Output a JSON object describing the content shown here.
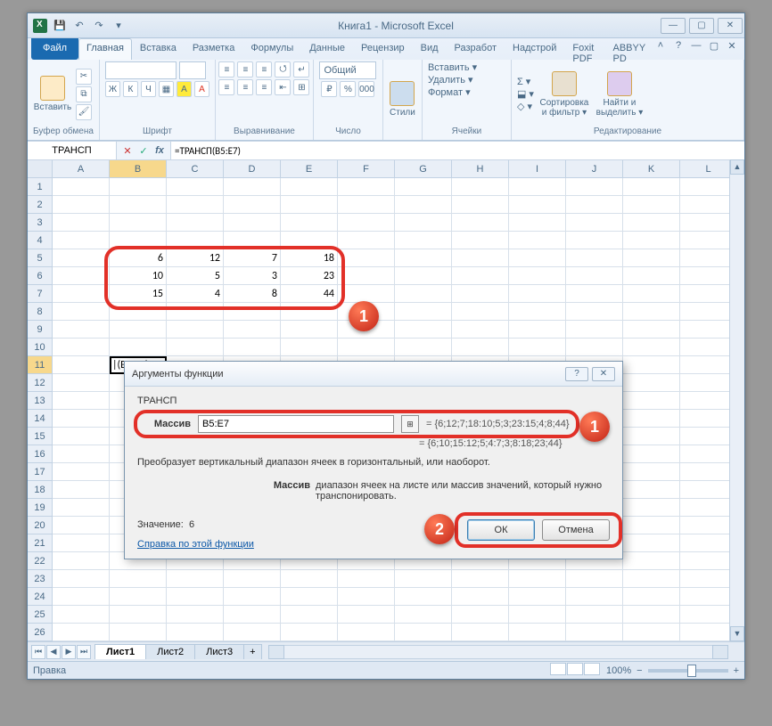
{
  "title": "Книга1 - Microsoft Excel",
  "qat": {
    "save": "💾",
    "undo": "↶",
    "redo": "↷",
    "down": "▾"
  },
  "win": {
    "min": "—",
    "max": "▢",
    "close": "✕"
  },
  "tabs": {
    "file": "Файл",
    "items": [
      "Главная",
      "Вставка",
      "Разметка",
      "Формулы",
      "Данные",
      "Рецензир",
      "Вид",
      "Разработ",
      "Надстрой",
      "Foxit PDF",
      "ABBYY PD"
    ],
    "active": 0
  },
  "help": {
    "min": "˄",
    "q": "?",
    "wmin": "—",
    "wmax": "▢",
    "wclose": "✕"
  },
  "ribbon": {
    "clipboard": {
      "paste": "Вставить",
      "label": "Буфер обмена"
    },
    "font": {
      "label": "Шрифт",
      "bold": "Ж",
      "italic": "К",
      "underline": "Ч"
    },
    "align": {
      "label": "Выравнивание"
    },
    "number": {
      "format": "Общий",
      "label": "Число"
    },
    "styles": {
      "btn": "Стили"
    },
    "cells": {
      "insert": "Вставить ▾",
      "delete": "Удалить ▾",
      "format": "Формат ▾",
      "label": "Ячейки"
    },
    "editing": {
      "sort": "Сортировка\nи фильтр ▾",
      "find": "Найти и\nвыделить ▾",
      "label": "Редактирование",
      "sum": "Σ ▾",
      "fill": "⬓ ▾",
      "clear": "◇ ▾"
    }
  },
  "formula_bar": {
    "name_box": "ТРАНСП",
    "cancel": "✕",
    "accept": "✓",
    "fx": "fx",
    "formula": "=ТРАНСП(B5:E7)"
  },
  "columns": [
    "A",
    "B",
    "C",
    "D",
    "E",
    "F",
    "G",
    "H",
    "I",
    "J",
    "K",
    "L"
  ],
  "grid": {
    "r5": {
      "B": "6",
      "C": "12",
      "D": "7",
      "E": "18"
    },
    "r6": {
      "B": "10",
      "C": "5",
      "D": "3",
      "E": "23"
    },
    "r7": {
      "B": "15",
      "C": "4",
      "D": "8",
      "E": "44"
    },
    "r11": {
      "B": "|(B5:E7)"
    }
  },
  "dialog": {
    "title": "Аргументы функции",
    "func": "ТРАНСП",
    "arg_label": "Массив",
    "arg_value": "B5:E7",
    "arg_preview": "= {6;12;7;18:10;5;3;23:15;4;8;44}",
    "result_preview": "= {6;10;15:12;5;4:7;3;8:18;23;44}",
    "desc": "Преобразует вертикальный диапазон ячеек в горизонтальный, или наоборот.",
    "arg_name": "Массив",
    "arg_desc": "диапазон ячеек на листе или массив значений, который нужно транспонировать.",
    "value_label": "Значение:",
    "value": "6",
    "help": "Справка по этой функции",
    "ok": "ОК",
    "cancel": "Отмена",
    "help_btn": "?",
    "close_btn": "✕",
    "range_icon": "⊞"
  },
  "sheets": {
    "s1": "Лист1",
    "s2": "Лист2",
    "s3": "Лист3",
    "add": "+"
  },
  "sheet_nav": {
    "first": "⏮",
    "prev": "◀",
    "next": "▶",
    "last": "⏭"
  },
  "status": {
    "mode": "Правка",
    "zoom": "100%",
    "minus": "−",
    "plus": "+"
  },
  "callouts": {
    "c1": "1",
    "c1b": "1",
    "c2": "2"
  }
}
